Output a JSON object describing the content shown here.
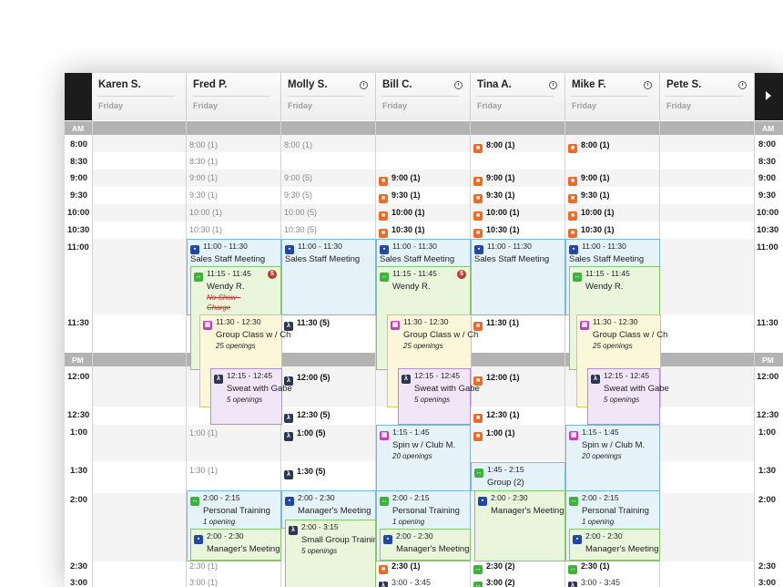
{
  "staff": [
    {
      "name": "Karen S.",
      "day": "Friday",
      "clock": false
    },
    {
      "name": "Fred P.",
      "day": "Friday",
      "clock": false
    },
    {
      "name": "Molly S.",
      "day": "Friday",
      "clock": true
    },
    {
      "name": "Bill C.",
      "day": "Friday",
      "clock": true
    },
    {
      "name": "Tina A.",
      "day": "Friday",
      "clock": true
    },
    {
      "name": "Mike F.",
      "day": "Friday",
      "clock": true
    },
    {
      "name": "Pete S.",
      "day": "Friday",
      "clock": true
    }
  ],
  "sections": {
    "am": "AM",
    "pm": "PM"
  },
  "times": [
    "8:00",
    "8:30",
    "9:00",
    "9:30",
    "10:00",
    "10:30",
    "11:00",
    "11:30",
    "12:00",
    "12:30",
    "1:00",
    "1:30",
    "2:00",
    "2:30",
    "3:00"
  ],
  "slots": {
    "fred": [
      "8:00 (1)",
      "8:30 (1)",
      "9:00 (1)",
      "9:30 (1)",
      "10:00 (1)",
      "10:30 (1)",
      "1:00 (1)",
      "1:30 (1)",
      "2:30 (1)",
      "3:00 (1)"
    ],
    "molly": [
      "8:00 (1)",
      "9:00 (5)",
      "9:30 (5)",
      "10:00 (5)",
      "10:30 (5)",
      "11:30 (5)",
      "12:00 (5)",
      "12:30 (5)",
      "1:00 (5)",
      "1:30 (5)"
    ],
    "bill": [
      "9:00 (1)",
      "9:30 (1)",
      "10:00 (1)",
      "10:30 (1)",
      "2:30 (1)",
      "3:00 - 3:45"
    ],
    "tina": [
      "8:00 (1)",
      "9:00 (1)",
      "9:30 (1)",
      "10:00 (1)",
      "10:30 (1)",
      "11:30 (1)",
      "12:00 (1)",
      "12:30 (1)",
      "1:00 (1)",
      "2:30 (2)",
      "3:00 (2)"
    ],
    "mike": [
      "8:00 (1)",
      "9:00 (1)",
      "9:30 (1)",
      "10:00 (1)",
      "10:30 (1)",
      "2:30 (1)",
      "3:00 - 3:45"
    ]
  },
  "events": {
    "sales_time": "11:00 - 11:30",
    "sales_title": "Sales Staff Meeting",
    "pt_time": "11:15 - 11:45",
    "pt_client": "Wendy R.",
    "pt_noshow": "No Show -",
    "pt_charge": "Charge",
    "group_time": "11:30 - 12:30",
    "group_title": "Group Class w / Ch",
    "group_openings": "25 openings",
    "sweat_time": "12:15 - 12:45",
    "sweat_title": "Sweat with Gabe",
    "sweat_openings": "5 openings",
    "spin_time": "1:15 - 1:45",
    "spin_title": "Spin w / Club M.",
    "spin_openings": "20 openings",
    "group2_time": "1:45 - 2:15",
    "group2_title": "Group (2)",
    "ptr_time": "2:00 - 2:15",
    "ptr_title": "Personal Training",
    "ptr_opening": "1 opening",
    "mgr_time": "2:00 - 2:30",
    "mgr_title": "Manager's Meeting",
    "sgt_time": "2:00 - 3:15",
    "sgt_title": "Small Group Training",
    "sgt_openings": "5 openings",
    "dollar": "$"
  },
  "colors": {
    "header_black": "#1c1c1c",
    "section_grey": "#b3b3b3",
    "orange_icon": "#f06a25",
    "green_icon": "#3cb43c",
    "navy_icon": "#2d3654"
  }
}
